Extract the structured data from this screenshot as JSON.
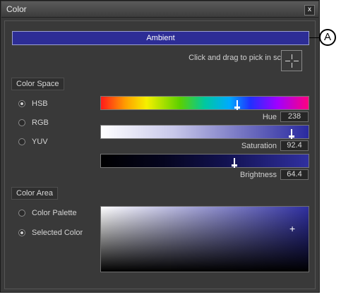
{
  "window": {
    "title": "Color",
    "close_glyph": "x"
  },
  "ambient": {
    "label": "Ambient",
    "color": "#2d2d96"
  },
  "picker": {
    "hint": "Click and drag to pick in screen",
    "icon": "crosshair-icon"
  },
  "color_space": {
    "header": "Color Space",
    "options": [
      {
        "label": "HSB",
        "selected": true
      },
      {
        "label": "RGB",
        "selected": false
      },
      {
        "label": "YUV",
        "selected": false
      }
    ]
  },
  "sliders": {
    "hue": {
      "label": "Hue",
      "value": "238",
      "fraction": 0.66
    },
    "saturation": {
      "label": "Saturation",
      "value": "92.4",
      "fraction": 0.924
    },
    "brightness": {
      "label": "Brightness",
      "value": "64.4",
      "fraction": 0.644
    }
  },
  "color_area": {
    "header": "Color Area",
    "options": [
      {
        "label": "Color Palette",
        "selected": false
      },
      {
        "label": "Selected Color",
        "selected": true
      }
    ],
    "marker_glyph": "+"
  },
  "callout": {
    "label": "A"
  }
}
